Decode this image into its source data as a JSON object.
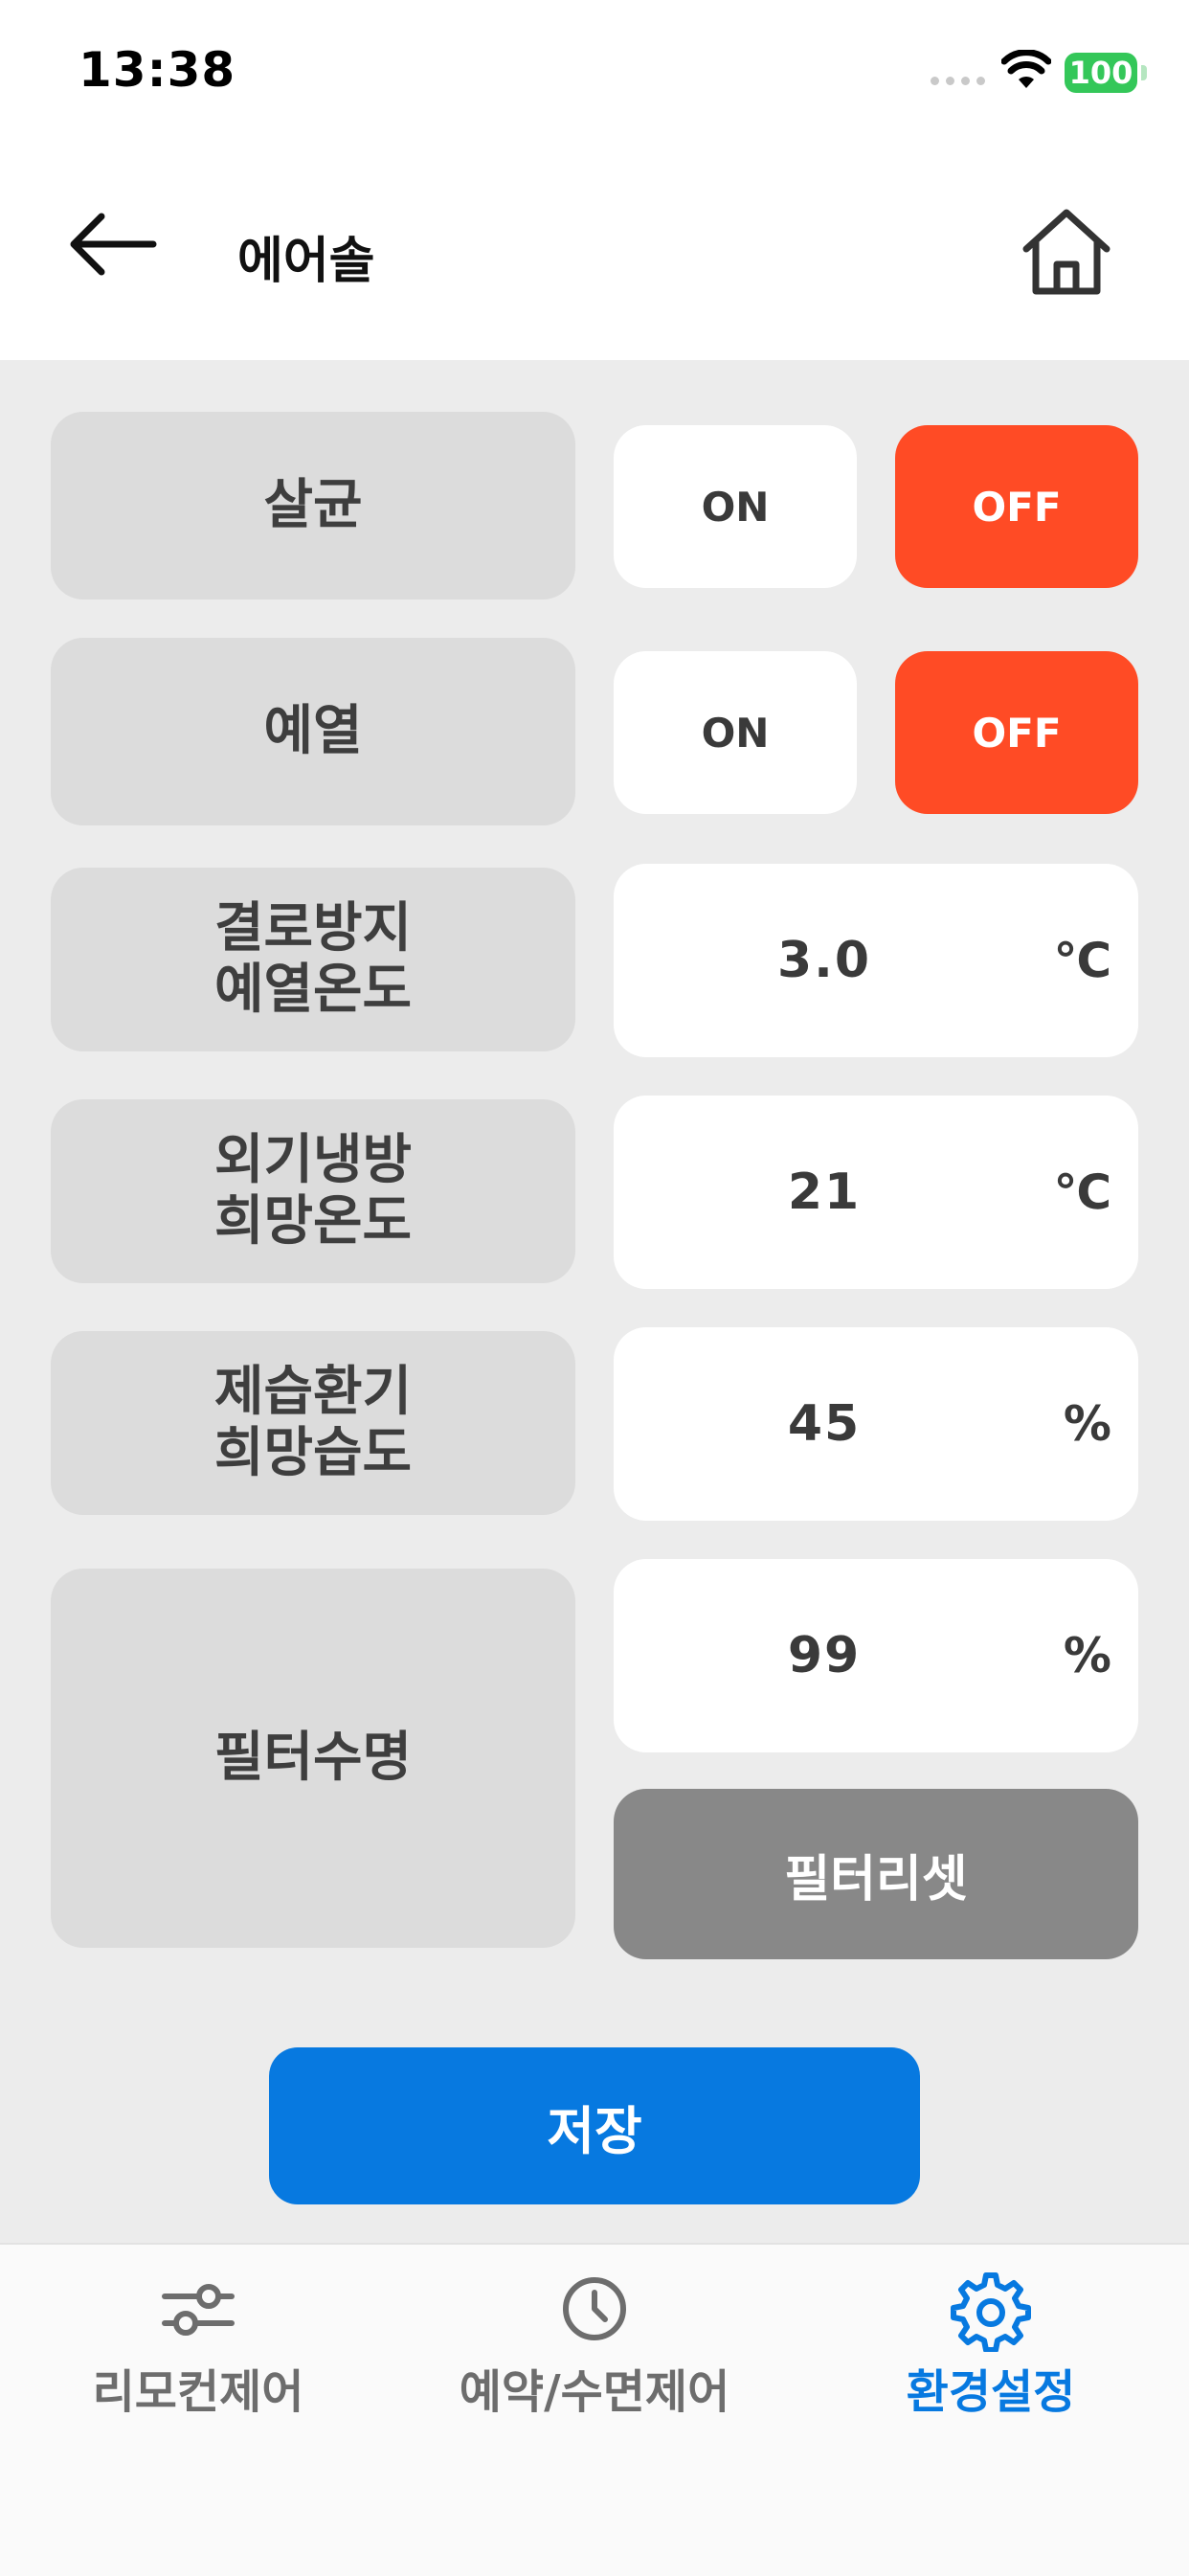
{
  "status_bar": {
    "time": "13:38",
    "battery": "100"
  },
  "header": {
    "title": "에어솔",
    "back_icon": "arrow-left-icon",
    "home_icon": "home-icon"
  },
  "settings": {
    "sterilization": {
      "label": "살균",
      "on_label": "ON",
      "off_label": "OFF",
      "state": "OFF"
    },
    "preheat": {
      "label": "예열",
      "on_label": "ON",
      "off_label": "OFF",
      "state": "OFF"
    },
    "condensation_preheat_temp": {
      "label": "결로방지\n예열온도",
      "value": "3.0",
      "unit": "℃"
    },
    "outdoor_cooling_temp": {
      "label": "외기냉방\n희망온도",
      "value": "21",
      "unit": "℃"
    },
    "dehumid_vent_humidity": {
      "label": "제습환기\n희망습도",
      "value": "45",
      "unit": "%"
    },
    "filter_life": {
      "label": "필터수명",
      "value": "99",
      "unit": "%",
      "reset_label": "필터리셋"
    }
  },
  "save_label": "저장",
  "colors": {
    "accent": "#0779e0",
    "off_active": "#ff4b25",
    "reset_gray": "#888888"
  },
  "tabbar": {
    "items": [
      {
        "label": "리모컨제어",
        "icon": "sliders-icon",
        "active": false
      },
      {
        "label": "예약/수면제어",
        "icon": "clock-icon",
        "active": false
      },
      {
        "label": "환경설정",
        "icon": "gear-icon",
        "active": true
      }
    ]
  }
}
